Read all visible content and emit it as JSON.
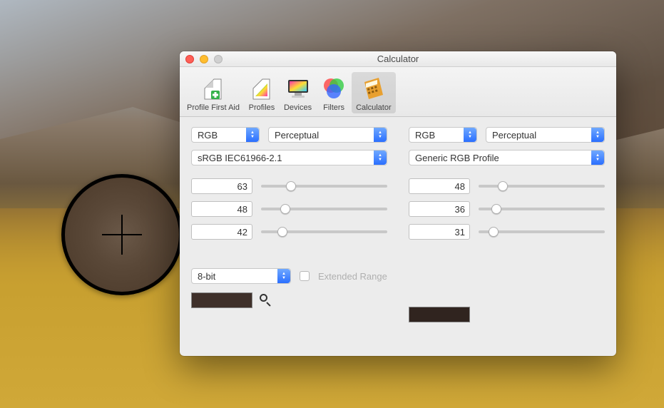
{
  "window": {
    "title": "Calculator"
  },
  "toolbar": {
    "items": [
      {
        "label": "Profile First Aid"
      },
      {
        "label": "Profiles"
      },
      {
        "label": "Devices"
      },
      {
        "label": "Filters"
      },
      {
        "label": "Calculator"
      }
    ],
    "active_index": 4
  },
  "left": {
    "color_space": "RGB",
    "intent": "Perceptual",
    "profile": "sRGB IEC61966-2.1",
    "channels": [
      {
        "value": "63",
        "percent": 24
      },
      {
        "value": "48",
        "percent": 19
      },
      {
        "value": "42",
        "percent": 17
      }
    ],
    "bit_depth": "8-bit",
    "extended_range_label": "Extended Range",
    "swatch_color": "#3f302a"
  },
  "right": {
    "color_space": "RGB",
    "intent": "Perceptual",
    "profile": "Generic RGB Profile",
    "channels": [
      {
        "value": "48",
        "percent": 19
      },
      {
        "value": "36",
        "percent": 14
      },
      {
        "value": "31",
        "percent": 12
      }
    ],
    "swatch_color": "#30241f"
  }
}
